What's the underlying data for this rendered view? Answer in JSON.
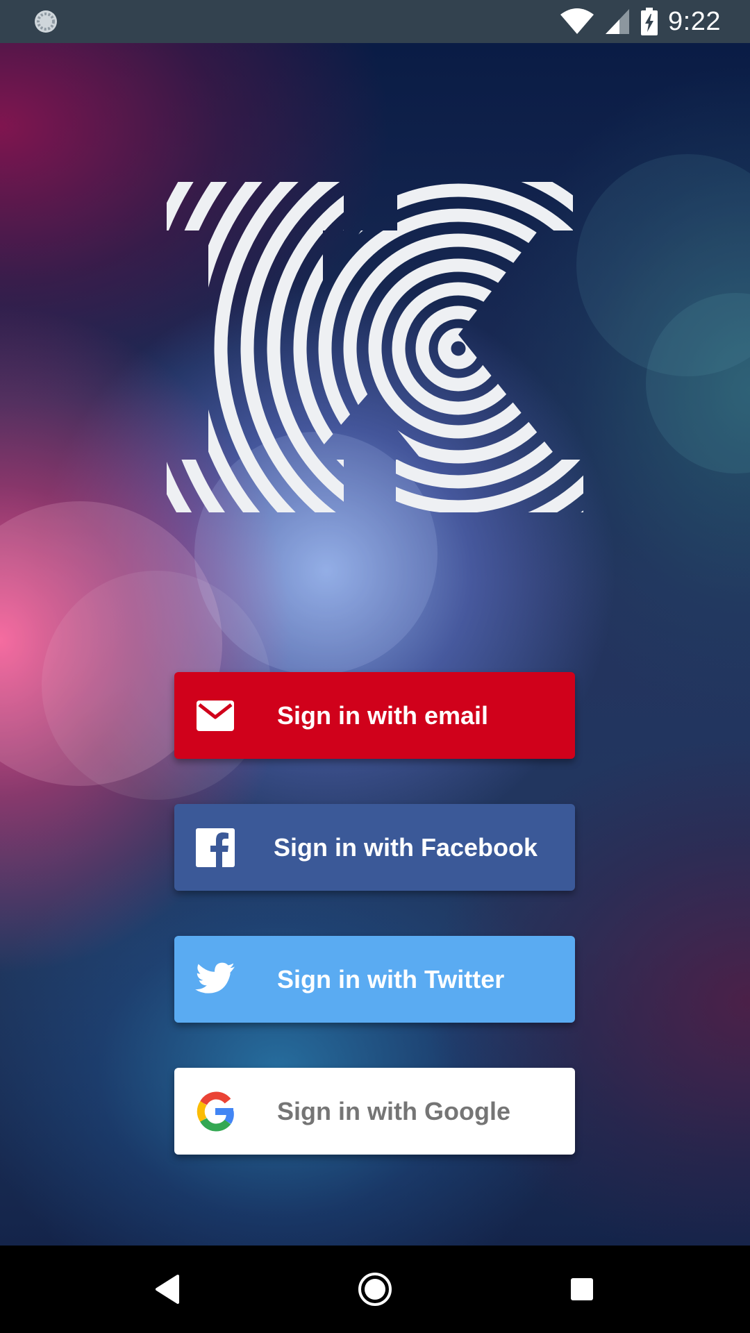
{
  "status_bar": {
    "time": "9:22",
    "icons": [
      "loading-spinner-icon",
      "wifi-icon",
      "cell-signal-icon",
      "battery-charging-icon"
    ]
  },
  "logo": {
    "icon": "k-logo-concentric-circles",
    "color": "#eef0f3"
  },
  "sign_in_buttons": [
    {
      "label": "Sign in with email",
      "icon": "mail-icon",
      "background": "#d0011b",
      "text_color": "#ffffff"
    },
    {
      "label": "Sign in with Facebook",
      "icon": "facebook-icon",
      "background": "#3b5998",
      "text_color": "#ffffff"
    },
    {
      "label": "Sign in with Twitter",
      "icon": "twitter-icon",
      "background": "#5aabf2",
      "text_color": "#ffffff"
    },
    {
      "label": "Sign in with Google",
      "icon": "google-icon",
      "background": "#ffffff",
      "text_color": "#757575"
    }
  ],
  "nav_bar": {
    "icons": [
      "back-icon",
      "home-icon",
      "recents-icon"
    ]
  }
}
